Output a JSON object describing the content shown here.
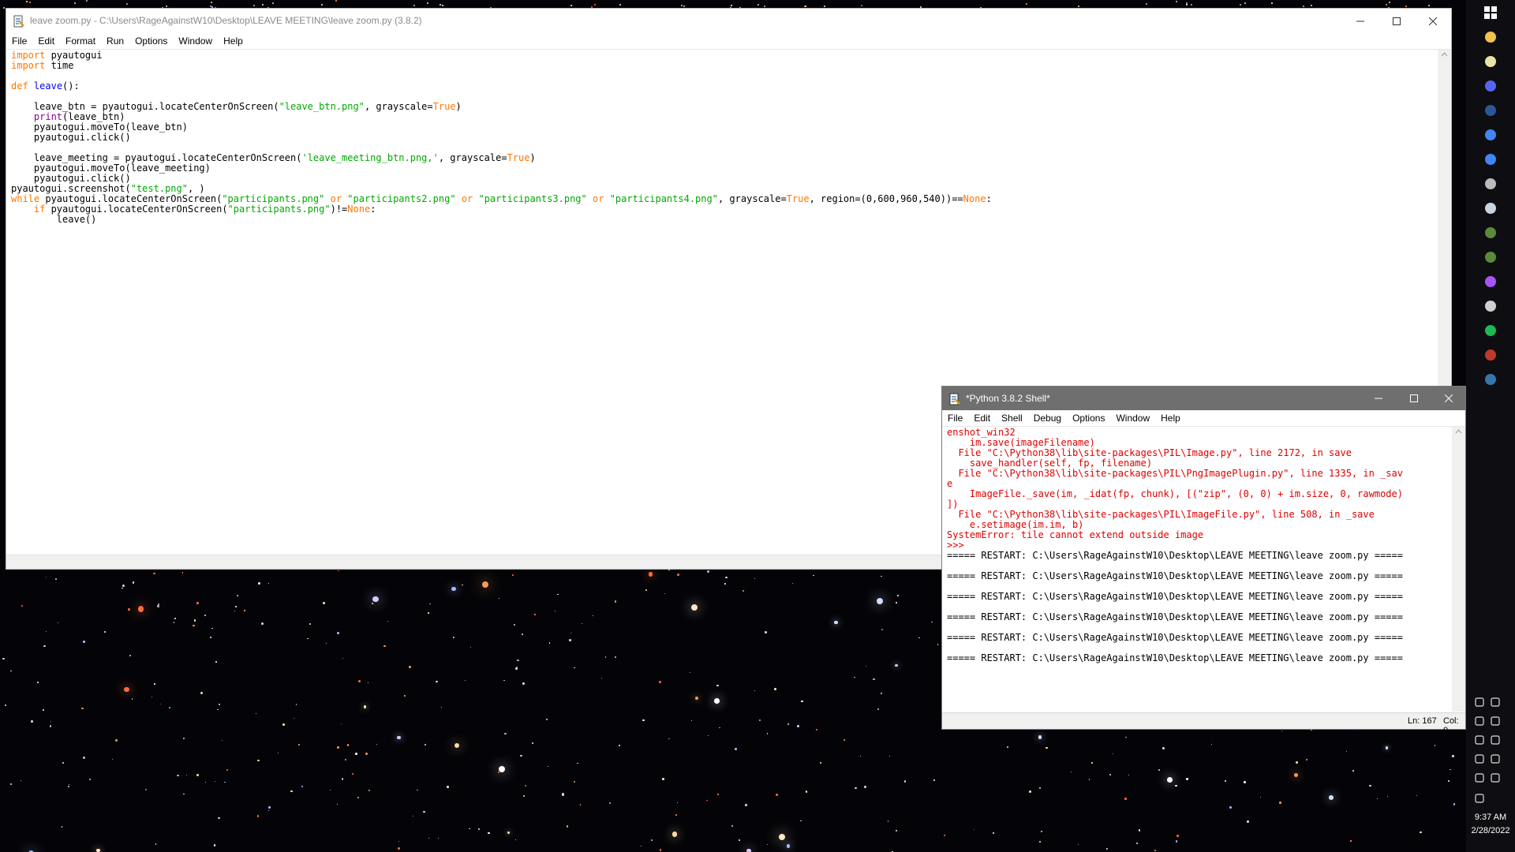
{
  "editor": {
    "title": "leave zoom.py - C:\\Users\\RageAgainstW10\\Desktop\\LEAVE MEETING\\leave zoom.py (3.8.2)",
    "menu": [
      "File",
      "Edit",
      "Format",
      "Run",
      "Options",
      "Window",
      "Help"
    ],
    "code_lines": [
      "import pyautogui",
      "import time",
      "",
      "def leave():",
      "",
      "    leave_btn = pyautogui.locateCenterOnScreen(\"leave_btn.png\", grayscale=True)",
      "    print(leave_btn)",
      "    pyautogui.moveTo(leave_btn)",
      "    pyautogui.click()",
      "",
      "    leave_meeting = pyautogui.locateCenterOnScreen('leave_meeting_btn.png,', grayscale=True)",
      "    pyautogui.moveTo(leave_meeting)",
      "    pyautogui.click()",
      "pyautogui.screenshot(\"test.png\", )",
      "while pyautogui.locateCenterOnScreen(\"participants.png\" or \"participants2.png\" or \"participants3.png\" or \"participants4.png\", grayscale=True, region=(0,600,960,540))==None:",
      "    if pyautogui.locateCenterOnScreen(\"participants.png\")!=None:",
      "        leave()"
    ]
  },
  "shell": {
    "title": "*Python 3.8.2 Shell*",
    "menu": [
      "File",
      "Edit",
      "Shell",
      "Debug",
      "Options",
      "Window",
      "Help"
    ],
    "output_lines": [
      {
        "text": "enshot_win32",
        "kind": "err"
      },
      {
        "text": "    im.save(imageFilename)",
        "kind": "err"
      },
      {
        "text": "  File \"C:\\Python38\\lib\\site-packages\\PIL\\Image.py\", line 2172, in save",
        "kind": "err"
      },
      {
        "text": "    save_handler(self, fp, filename)",
        "kind": "err"
      },
      {
        "text": "  File \"C:\\Python38\\lib\\site-packages\\PIL\\PngImagePlugin.py\", line 1335, in _sav",
        "kind": "err"
      },
      {
        "text": "e",
        "kind": "err"
      },
      {
        "text": "    ImageFile._save(im, _idat(fp, chunk), [(\"zip\", (0, 0) + im.size, 0, rawmode)",
        "kind": "err"
      },
      {
        "text": "])",
        "kind": "err"
      },
      {
        "text": "  File \"C:\\Python38\\lib\\site-packages\\PIL\\ImageFile.py\", line 508, in _save",
        "kind": "err"
      },
      {
        "text": "    e.setimage(im.im, b)",
        "kind": "err"
      },
      {
        "text": "SystemError: tile cannot extend outside image",
        "kind": "err"
      },
      {
        "text": ">>> ",
        "kind": "err"
      },
      {
        "text": "===== RESTART: C:\\Users\\RageAgainstW10\\Desktop\\LEAVE MEETING\\leave zoom.py =====",
        "kind": "restart"
      },
      {
        "text": "",
        "kind": "restart"
      },
      {
        "text": "===== RESTART: C:\\Users\\RageAgainstW10\\Desktop\\LEAVE MEETING\\leave zoom.py =====",
        "kind": "restart"
      },
      {
        "text": "",
        "kind": "restart"
      },
      {
        "text": "===== RESTART: C:\\Users\\RageAgainstW10\\Desktop\\LEAVE MEETING\\leave zoom.py =====",
        "kind": "restart"
      },
      {
        "text": "",
        "kind": "restart"
      },
      {
        "text": "===== RESTART: C:\\Users\\RageAgainstW10\\Desktop\\LEAVE MEETING\\leave zoom.py =====",
        "kind": "restart"
      },
      {
        "text": "",
        "kind": "restart"
      },
      {
        "text": "===== RESTART: C:\\Users\\RageAgainstW10\\Desktop\\LEAVE MEETING\\leave zoom.py =====",
        "kind": "restart"
      },
      {
        "text": "",
        "kind": "restart"
      },
      {
        "text": "===== RESTART: C:\\Users\\RageAgainstW10\\Desktop\\LEAVE MEETING\\leave zoom.py =====",
        "kind": "restart"
      }
    ],
    "status_ln": "Ln: 167",
    "status_col": "Col: 0"
  },
  "taskbar": {
    "apps": [
      "windows-start-icon",
      "file-explorer-icon",
      "notes-icon",
      "discord-icon",
      "word-icon",
      "chrome-icon",
      "chrome-alt-icon",
      "speaker-app-icon",
      "steam-icon",
      "minecraft-icon",
      "minecraft-alt-icon",
      "messenger-icon",
      "monitor-app-icon",
      "spotify-icon",
      "tool-icon",
      "python-idle-icon"
    ],
    "clock_time": "9:37 AM",
    "clock_date": "2/28/2022"
  },
  "colors": {
    "keyword": "#ff7700",
    "builtin": "#900090",
    "string": "#00aa00",
    "defname": "#0000ff",
    "error": "#dd0000",
    "shell_title_bg": "#6f6f6f"
  }
}
